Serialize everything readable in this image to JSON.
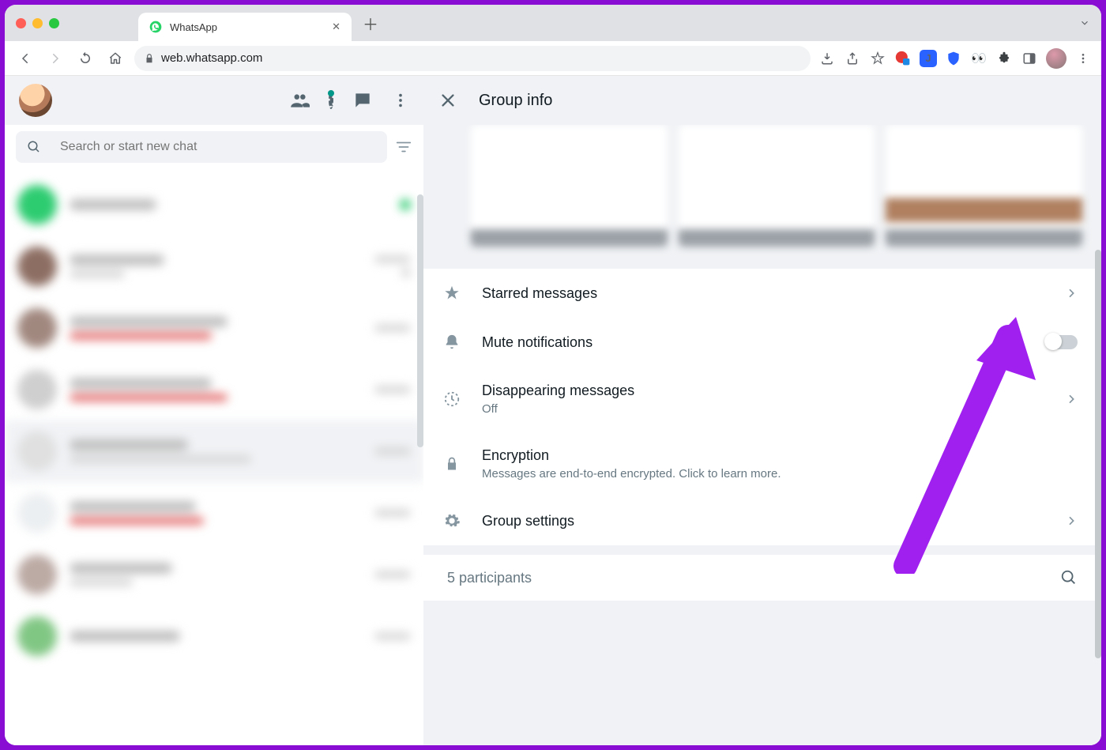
{
  "browser": {
    "tab_title": "WhatsApp",
    "url": "web.whatsapp.com"
  },
  "left": {
    "search_placeholder": "Search or start new chat"
  },
  "panel": {
    "title": "Group info",
    "items": {
      "starred": {
        "label": "Starred messages"
      },
      "mute": {
        "label": "Mute notifications"
      },
      "disappearing": {
        "label": "Disappearing messages",
        "value": "Off"
      },
      "encryption": {
        "label": "Encryption",
        "sub": "Messages are end-to-end encrypted. Click to learn more."
      },
      "group_settings": {
        "label": "Group settings"
      }
    },
    "participants_label": "5 participants"
  }
}
